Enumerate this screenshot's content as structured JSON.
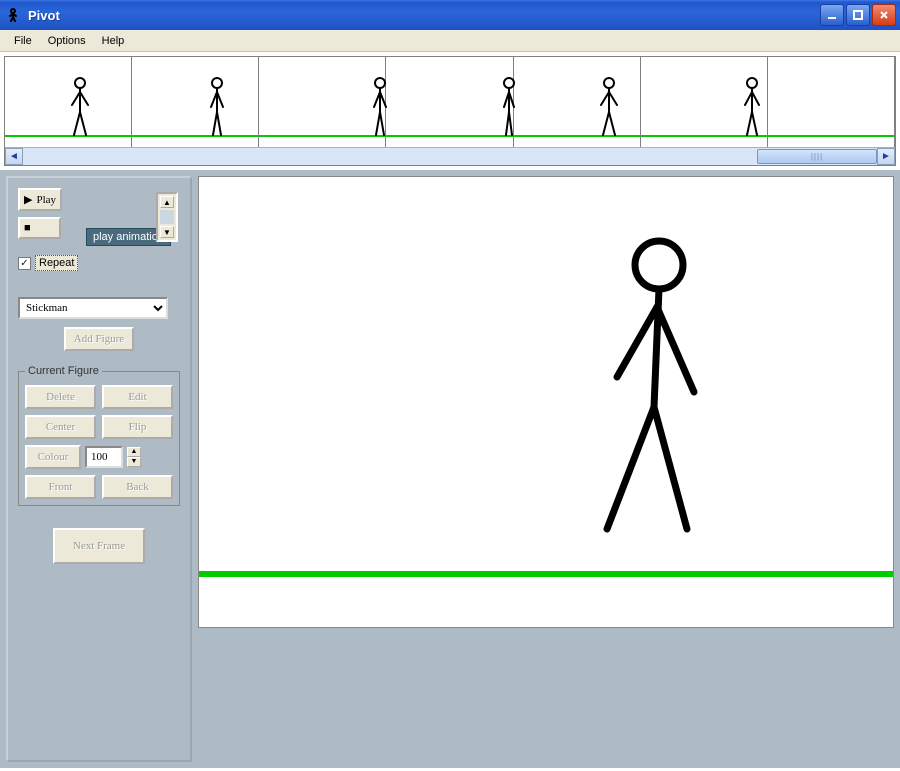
{
  "window": {
    "title": "Pivot"
  },
  "menu": {
    "file": "File",
    "options": "Options",
    "help": "Help"
  },
  "controls": {
    "play": "Play",
    "stop": "Stop",
    "repeat": "Repeat",
    "tooltip": "play animation"
  },
  "figure_select": {
    "options": [
      "Stickman"
    ],
    "selected": "Stickman",
    "add": "Add Figure"
  },
  "current_figure": {
    "legend": "Current Figure",
    "delete": "Delete",
    "edit": "Edit",
    "center": "Center",
    "flip": "Flip",
    "colour": "Colour",
    "size": "100",
    "front": "Front",
    "back": "Back"
  },
  "next_frame": "Next Frame",
  "timeline": {
    "frame_count": 6
  }
}
